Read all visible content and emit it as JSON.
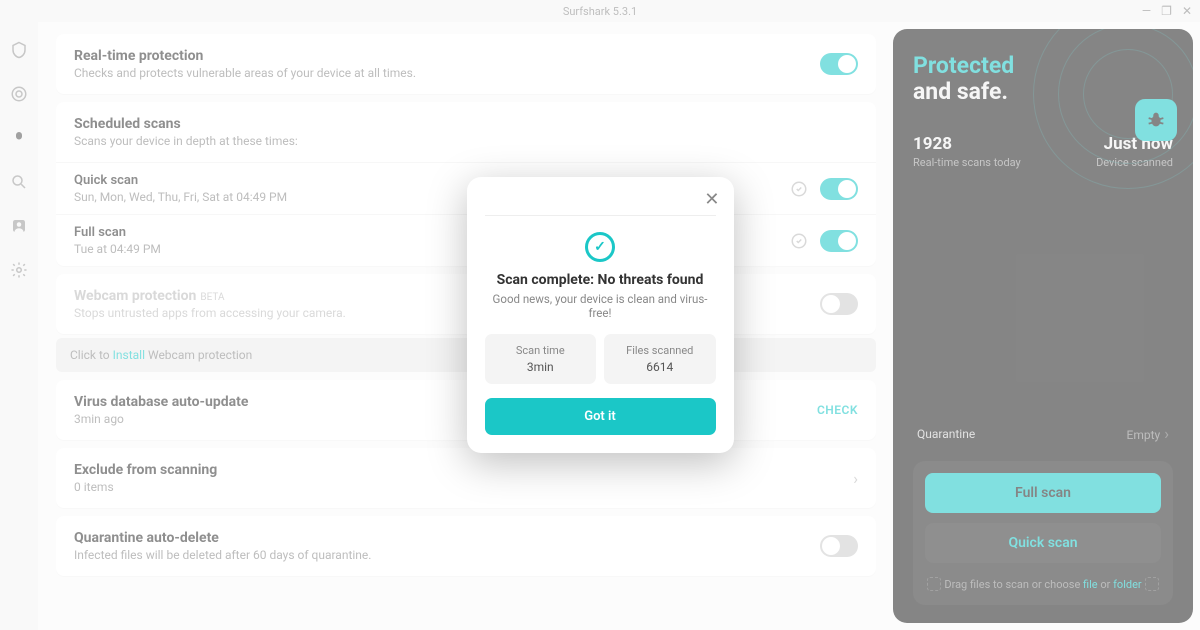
{
  "titlebar": {
    "title": "Surfshark 5.3.1"
  },
  "settings": {
    "realtime": {
      "title": "Real-time protection",
      "sub": "Checks and protects vulnerable areas of your device at all times."
    },
    "scheduled": {
      "title": "Scheduled scans",
      "sub": "Scans your device in depth at these times:"
    },
    "quick": {
      "title": "Quick scan",
      "sub": "Sun, Mon, Wed, Thu, Fri, Sat at 04:49 PM"
    },
    "full": {
      "title": "Full scan",
      "sub": "Tue at 04:49 PM"
    },
    "webcam": {
      "title": "Webcam protection",
      "beta": "BETA",
      "sub": "Stops untrusted apps from accessing your camera."
    },
    "install": {
      "prefix": "Click to ",
      "link": "Install",
      "suffix": " Webcam protection"
    },
    "virusdb": {
      "title": "Virus database auto-update",
      "sub": "3min ago",
      "check": "CHECK"
    },
    "exclude": {
      "title": "Exclude from scanning",
      "sub": "0 items"
    },
    "quarantine": {
      "title": "Quarantine auto-delete",
      "sub": "Infected files will be deleted after 60 days of quarantine."
    }
  },
  "panel": {
    "protected": "Protected",
    "andsafe": "and safe.",
    "scansNum": "1928",
    "scansLabel": "Real-time scans today",
    "justnow": "Just now",
    "deviceScanned": "Device scanned",
    "quarantine": "Quarantine",
    "empty": "Empty",
    "fullScan": "Full scan",
    "quickScan": "Quick scan",
    "dragText": "Drag files to scan or choose ",
    "file": "file",
    "or": " or ",
    "folder": "folder"
  },
  "modal": {
    "title": "Scan complete: No threats found",
    "sub": "Good news, your device is clean and virus-free!",
    "scanTimeLabel": "Scan time",
    "scanTimeVal": "3min",
    "filesLabel": "Files scanned",
    "filesVal": "6614",
    "gotIt": "Got it"
  }
}
